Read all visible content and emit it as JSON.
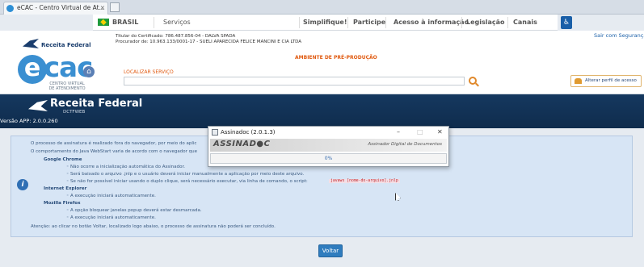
{
  "browser": {
    "tab_title": "eCAC - Centro Virtual de At...",
    "tab_close": "×",
    "tab_icon": "ecac-favicon-icon",
    "new_tab_icon": "new-tab-icon"
  },
  "gov_bar": {
    "items": [
      "BRASIL",
      "Serviços",
      "Simplifique!",
      "Participe",
      "Acesso à informação",
      "Legislação",
      "Canais"
    ],
    "accessibility_icon": "accessibility-icon"
  },
  "header": {
    "receita_logo_text": "Receita Federal",
    "ecac_e": "e",
    "ecac_cac": "cac",
    "ecac_subtitle": "CENTRO VIRTUAL DE ATENDIMENTO",
    "home_icon": "home-icon",
    "cert_line1": "Titular do Certificado: 786.487.856-04 - DALVA SPADA",
    "cert_line2": "Procurador de: 10.963.133/0001-17 - SUELI APARECIDA FELICE MANCINI E CIA LTDA",
    "sair": "Sair com Segurança",
    "ambiente": "AMBIENTE DE PRÉ-PRODUÇÃO",
    "localizar_label": "LOCALIZAR SERVIÇO",
    "localizar_value": "",
    "search_icon": "search-icon",
    "alterar_perfil": "Alterar perfil de acesso",
    "perfil_icon": "people-icon"
  },
  "banner": {
    "title": "Receita Federal",
    "subtitle": "DCTFWEB",
    "version": "Versão APP: 2.0.0.260"
  },
  "info": {
    "icon": "info-icon",
    "line1": "O processo de assinatura é realizado fora do navegador, por meio do aplic",
    "line2": "O comportamento do Java WebStart varia de acordo com o navegador que",
    "chrome": "Google Chrome",
    "chrome_1": "Não ocorre a inicialização automática do Assinador.",
    "chrome_2": "Será baixado o arquivo .jnlp e o usuário deverá iniciar manualmente a aplicação por meio deste arquivo.",
    "chrome_3": "Se não for possível iniciar usando o duplo clique, será necessário executar, via linha de comando, o script:",
    "chrome_3_code": "javaws [nome-do-arquivo].jnlp",
    "ie": "Internet Explorer",
    "ie_1": "A execução iniciará automaticamente.",
    "firefox": "Mozilla Firefox",
    "firefox_1": "A opção bloquear janelas popup deverá estar desmarcada.",
    "firefox_2": "A execução iniciará automaticamente.",
    "warning": "Atenção: ao clicar no botão Voltar, localizado logo abaixo, o processo de assinatura não poderá ser concluído."
  },
  "voltar": "Voltar",
  "dialog": {
    "title": "Assinadoc (2.0.1.3)",
    "app_icon": "java-app-icon",
    "minimize": "–",
    "maximize": "□",
    "close": "✕",
    "brand": "ASSINAD●C",
    "tagline": "Assinador Digital de Documentos",
    "progress_text": "0%",
    "progress": 0
  },
  "cursor_icon": "mouse-cursor-icon",
  "colors": {
    "banner_bg": "#15385f",
    "info_bg": "#d7e5f5",
    "button": "#2f7cbe",
    "ambiente": "#e05a10"
  }
}
